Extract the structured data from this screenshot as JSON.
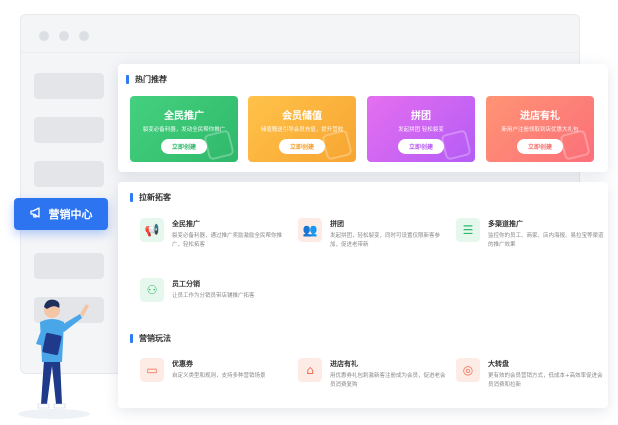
{
  "hot": {
    "title": "热门推荐",
    "cards": [
      {
        "title": "全民推广",
        "desc": "裂变必备利器，发动全民帮你推广",
        "button": "立即创建",
        "color_from": "#44d17f",
        "color_to": "#2fb86a",
        "btn_color": "#2fb86a"
      },
      {
        "title": "会员储值",
        "desc": "储值赠送引导会员充值，提升营收",
        "button": "立即创建",
        "color_from": "#ffc24a",
        "color_to": "#f7a531",
        "btn_color": "#f5a02c"
      },
      {
        "title": "拼团",
        "desc": "发起拼团 轻松裂变",
        "button": "立即创建",
        "color_from": "#e56ff0",
        "color_to": "#b45cf5",
        "btn_color": "#b95df2"
      },
      {
        "title": "进店有礼",
        "desc": "新用户注册领取到店优惠大礼包",
        "button": "立即创建",
        "color_from": "#ff9474",
        "color_to": "#fb6f7a",
        "btn_color": "#f7706f"
      }
    ]
  },
  "acquire": {
    "title": "拉新拓客",
    "items": [
      {
        "name": "全民推广",
        "desc": "裂变必备利器，通过推广奖励激励全民帮你推广，轻松拓客",
        "icon": "megaphone-icon",
        "bg": "#e6f8ee",
        "fg": "#2fb86a",
        "glyph": "📢"
      },
      {
        "name": "拼团",
        "desc": "发起拼团，轻松裂变，同时可设置仅限新客参加，促进老带新",
        "icon": "group-icon",
        "bg": "#fdebe6",
        "fg": "#f26b4f",
        "glyph": "👥"
      },
      {
        "name": "多渠道推广",
        "desc": "监控你的员工、商家、店内海报、易拉宝等渠道的推广效果",
        "icon": "channel-icon",
        "bg": "#e6f8ee",
        "fg": "#2fb86a",
        "glyph": "☰"
      },
      {
        "name": "员工分销",
        "desc": "让员工作为分销员带店铺推广拓客",
        "icon": "distribution-icon",
        "bg": "#e6f8ee",
        "fg": "#2fb86a",
        "glyph": "⚇"
      }
    ]
  },
  "play": {
    "title": "营销玩法",
    "items": [
      {
        "name": "优惠券",
        "desc": "自定义类型和规则，支持多种营销场景",
        "icon": "coupon-icon",
        "bg": "#fdebe6",
        "fg": "#f26b4f",
        "glyph": "▭"
      },
      {
        "name": "进店有礼",
        "desc": "用优惠券礼包刺激新客注册成为会员，促进老会员消费复购",
        "icon": "store-gift-icon",
        "bg": "#fdebe6",
        "fg": "#f26b4f",
        "glyph": "⌂"
      },
      {
        "name": "大转盘",
        "desc": "更有效的会员营销方式，低成本+高效率促进会员消费和拉新",
        "icon": "wheel-icon",
        "bg": "#fdebe6",
        "fg": "#f26b4f",
        "glyph": "◎"
      }
    ]
  },
  "marketing_center": {
    "label": "营销中心",
    "icon": "megaphone-icon"
  }
}
